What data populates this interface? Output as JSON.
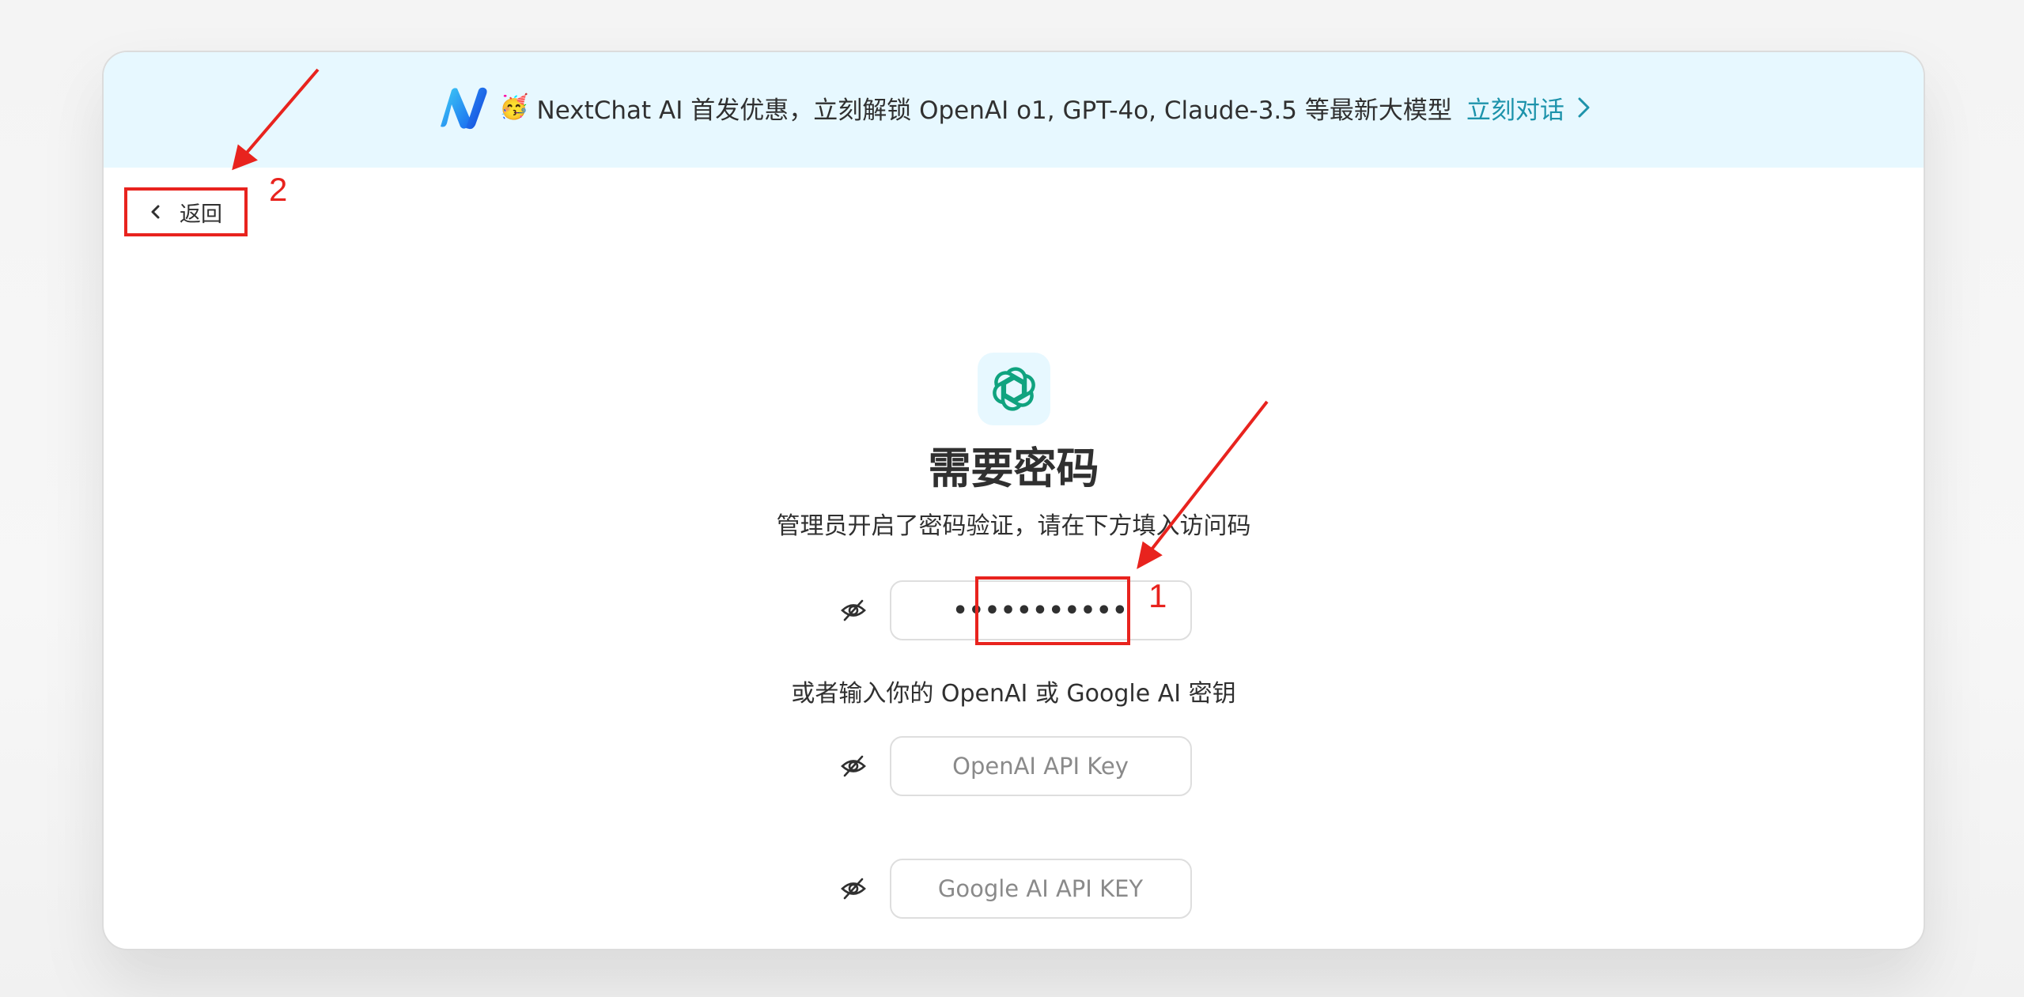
{
  "banner": {
    "brand_logo_icon": "nextchat-n-logo",
    "party_icon": "🥳",
    "text": "NextChat AI 首发优惠，立刻解锁 OpenAI o1, GPT-4o, Claude-3.5 等最新大模型",
    "link_label": "立刻对话",
    "link_icon": "chevron-right-icon",
    "background_color": "#e7f8ff",
    "link_color": "#1d93ab"
  },
  "back_button": {
    "icon": "chevron-left-icon",
    "label": "返回"
  },
  "auth": {
    "app_icon": "openai-logo",
    "title": "需要密码",
    "subtitle": "管理员开启了密码验证，请在下方填入访问码",
    "access_code": {
      "value": "•••••••••••",
      "visibility_icon": "eye-off-icon"
    },
    "or_text": "或者输入你的 OpenAI 或 Google AI 密钥",
    "openai_key": {
      "placeholder": "OpenAI API Key",
      "visibility_icon": "eye-off-icon"
    },
    "google_key": {
      "placeholder": "Google AI API KEY",
      "visibility_icon": "eye-off-icon"
    }
  },
  "annotations": [
    {
      "number": "1",
      "target": "access-code-input"
    },
    {
      "number": "2",
      "target": "back-button"
    }
  ],
  "annotation_color": "#e8231e"
}
